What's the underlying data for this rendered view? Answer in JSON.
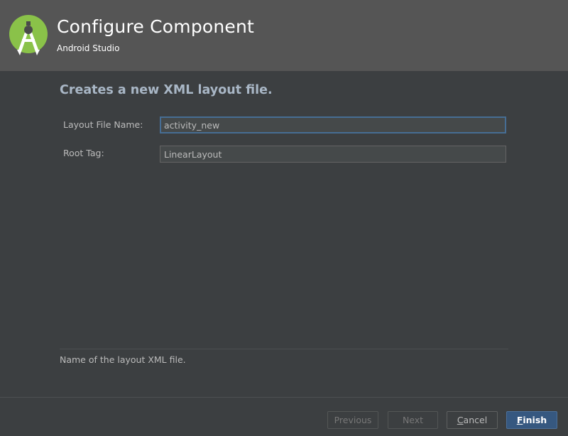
{
  "header": {
    "title": "Configure Component",
    "subtitle": "Android Studio",
    "logo_icon": "android-studio-logo-icon"
  },
  "main": {
    "title": "Creates a new XML layout file.",
    "fields": {
      "layout_file_name": {
        "label": "Layout File Name:",
        "value": "activity_new"
      },
      "root_tag": {
        "label": "Root Tag:",
        "value": "LinearLayout"
      }
    },
    "hint": "Name of the layout XML file."
  },
  "footer": {
    "previous": "Previous",
    "next": "Next",
    "cancel": {
      "mnemonic": "C",
      "rest": "ancel"
    },
    "finish": {
      "mnemonic": "F",
      "rest": "inish"
    }
  },
  "colors": {
    "background": "#3c3f41",
    "header": "#555555",
    "logo_green": "#8ac249",
    "title_text": "#a9b7c6",
    "focus_border": "#466d94",
    "default_button": "#365880"
  }
}
